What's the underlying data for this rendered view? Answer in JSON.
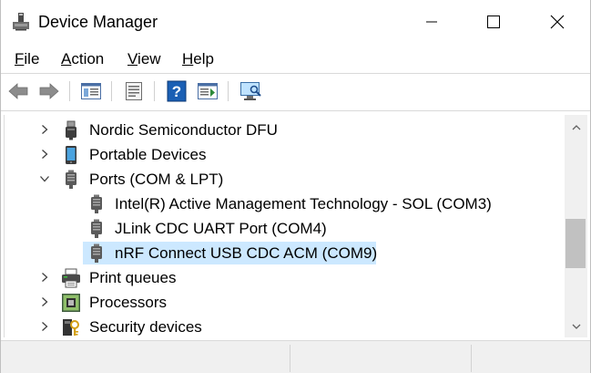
{
  "window": {
    "title": "Device Manager",
    "app_icon": "device-manager-icon",
    "controls": [
      "minimize",
      "maximize",
      "close"
    ]
  },
  "menu": {
    "items": [
      {
        "label": "File",
        "mnemonic": "F"
      },
      {
        "label": "Action",
        "mnemonic": "A"
      },
      {
        "label": "View",
        "mnemonic": "V"
      },
      {
        "label": "Help",
        "mnemonic": "H"
      }
    ]
  },
  "toolbar": {
    "buttons": [
      "back-icon",
      "forward-icon",
      "show-hide-console-tree-icon",
      "properties-icon",
      "help-icon",
      "action-pane-icon",
      "scan-hardware-icon"
    ]
  },
  "tree": {
    "rows": [
      {
        "label": "Nordic Semiconductor DFU",
        "expander": "collapsed",
        "icon": "usb-device-icon",
        "level": 0,
        "selected": false
      },
      {
        "label": "Portable Devices",
        "expander": "collapsed",
        "icon": "portable-device-icon",
        "level": 0,
        "selected": false
      },
      {
        "label": "Ports (COM & LPT)",
        "expander": "expanded",
        "icon": "port-icon",
        "level": 0,
        "selected": false
      },
      {
        "label": "Intel(R) Active Management Technology - SOL (COM3)",
        "expander": "none",
        "icon": "port-icon",
        "level": 1,
        "selected": false
      },
      {
        "label": "JLink CDC UART Port (COM4)",
        "expander": "none",
        "icon": "port-icon",
        "level": 1,
        "selected": false
      },
      {
        "label": "nRF Connect USB CDC ACM (COM9)",
        "expander": "none",
        "icon": "port-icon",
        "level": 1,
        "selected": true
      },
      {
        "label": "Print queues",
        "expander": "collapsed",
        "icon": "printer-icon",
        "level": 0,
        "selected": false
      },
      {
        "label": "Processors",
        "expander": "collapsed",
        "icon": "processor-icon",
        "level": 0,
        "selected": false
      },
      {
        "label": "Security devices",
        "expander": "collapsed",
        "icon": "security-device-icon",
        "level": 0,
        "selected": false
      }
    ]
  },
  "colors": {
    "selection": "#cce8ff",
    "scrollbar_track": "#f0f0f0",
    "scrollbar_thumb": "#c1c1c1",
    "statusbar": "#f0f0f0",
    "help_blue": "#1a5fb4"
  }
}
